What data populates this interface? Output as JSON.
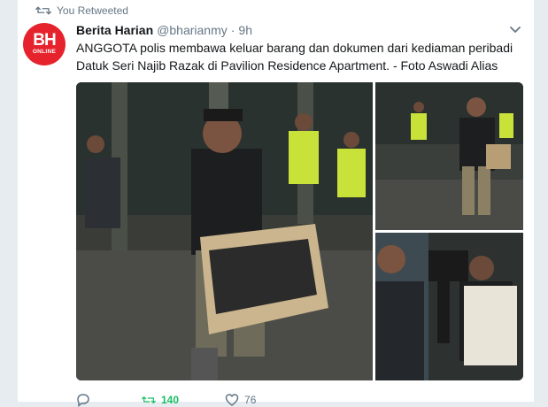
{
  "retweet_context": {
    "label": "You Retweeted"
  },
  "tweet": {
    "display_name": "Berita Harian",
    "handle": "@bharianmy",
    "separator": "·",
    "time": "9h",
    "text": "ANGGOTA polis membawa keluar barang dan dokumen dari kediaman peribadi Datuk Seri Najib Razak di Pavilion Residence Apartment. - Foto Aswadi Alias",
    "avatar": {
      "line1": "BH",
      "line2": "ONLINE",
      "color": "#e6232c"
    },
    "media": [
      {
        "name": "main-photo",
        "icon": "photo"
      },
      {
        "name": "top-right-photo",
        "icon": "photo"
      },
      {
        "name": "bottom-right-photo",
        "icon": "photo"
      }
    ]
  },
  "actions": {
    "reply": {
      "icon": "reply-icon",
      "count": ""
    },
    "retweet": {
      "icon": "retweet-icon",
      "count": "140",
      "color": "#17bf63"
    },
    "like": {
      "icon": "heart-icon",
      "count": "76"
    }
  },
  "colors": {
    "background": "#e6ecf0",
    "card": "#ffffff",
    "muted": "#657786",
    "text": "#14171a"
  }
}
